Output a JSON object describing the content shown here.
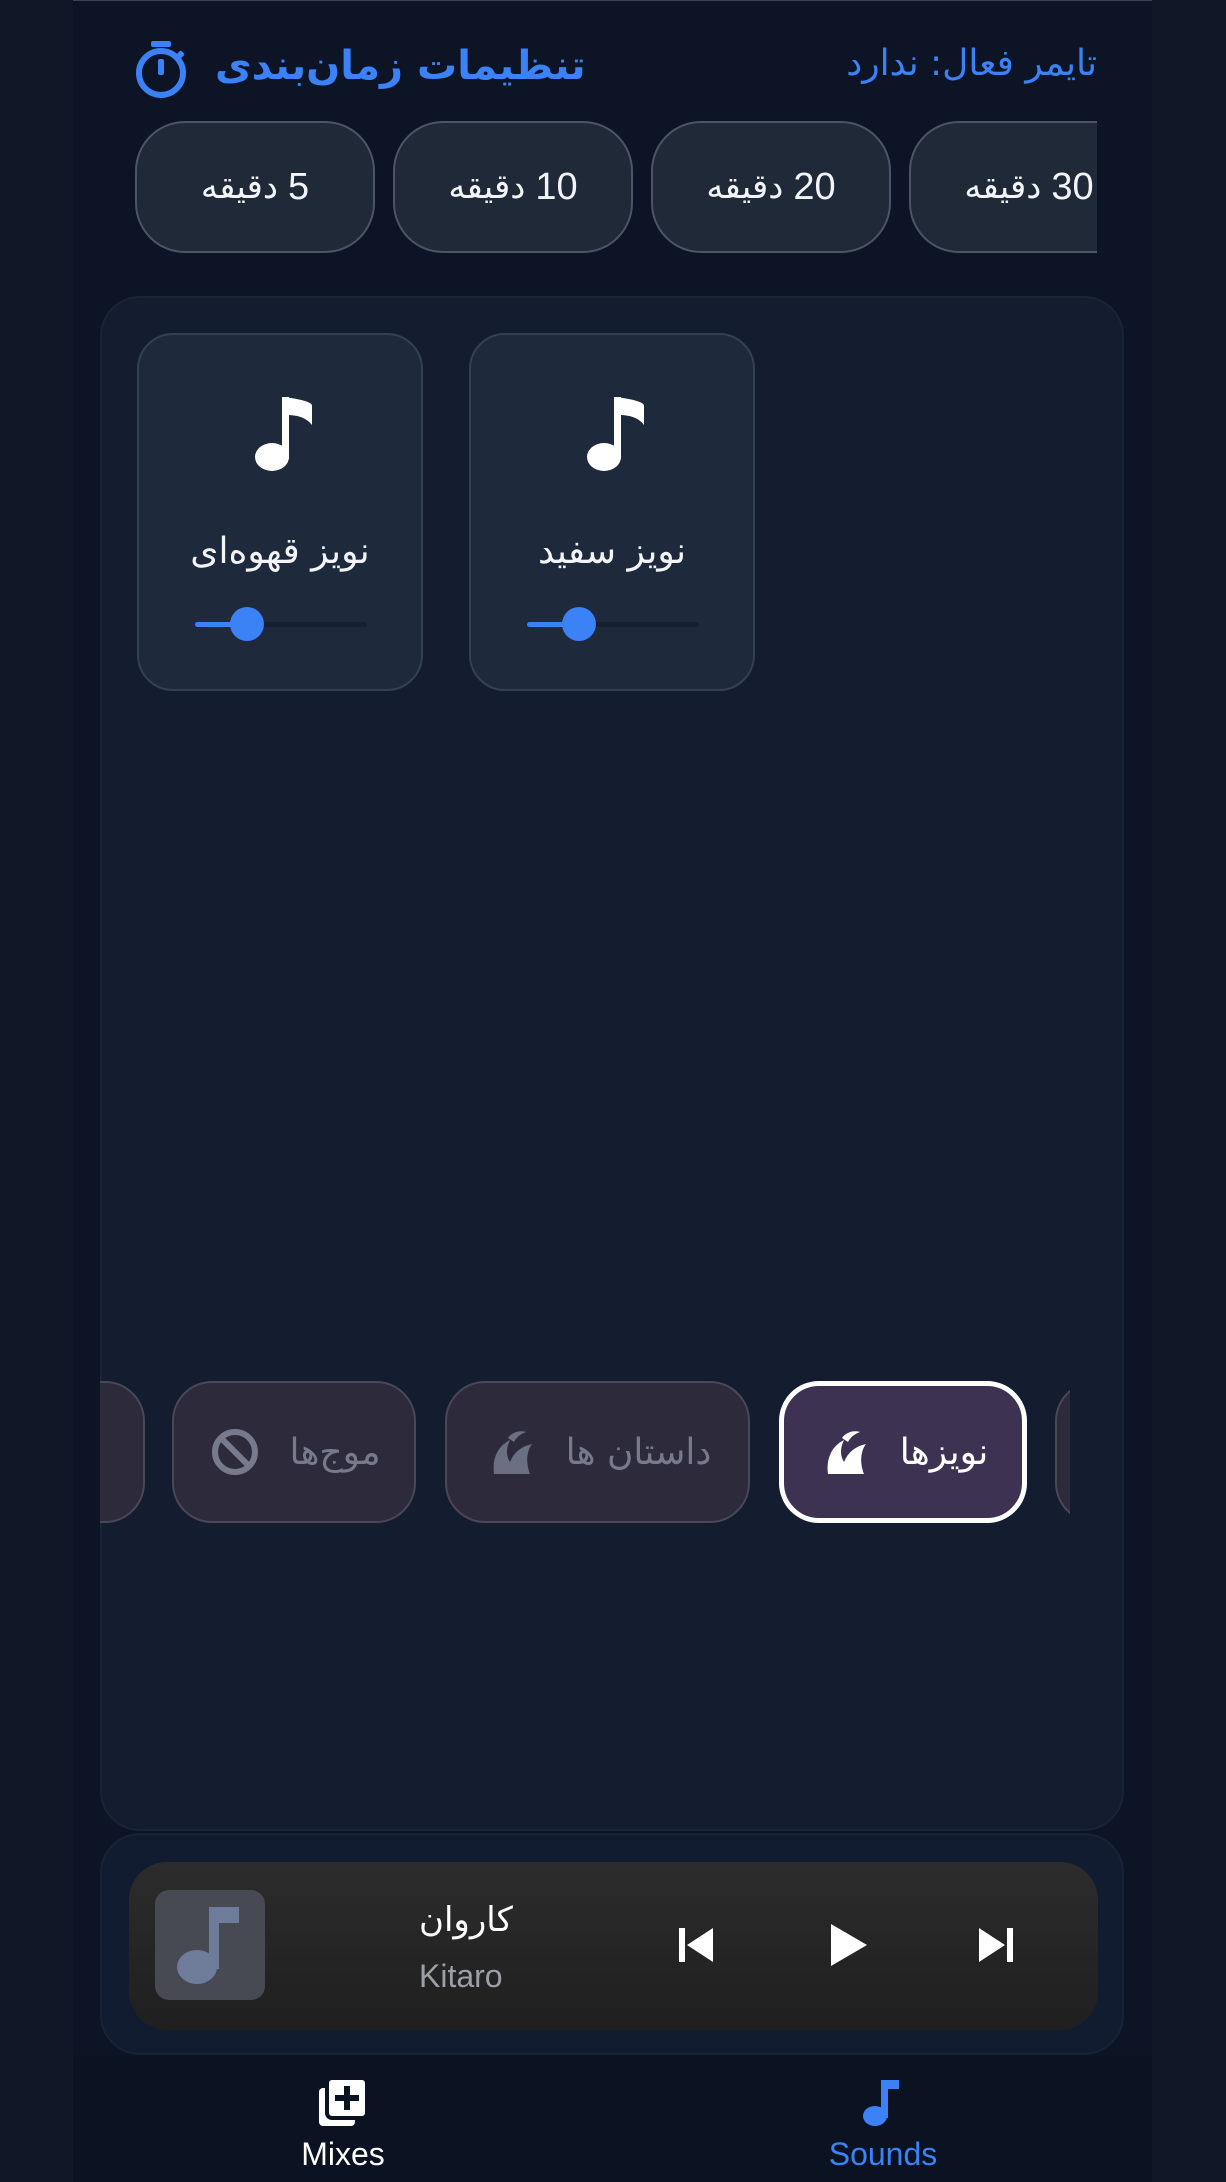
{
  "timer": {
    "title": "تنظیمات زمان‌بندی",
    "status": "تایمر فعال: ندارد",
    "options": [
      {
        "num": "5",
        "unit": "دقیقه"
      },
      {
        "num": "10",
        "unit": "دقیقه"
      },
      {
        "num": "20",
        "unit": "دقیقه"
      },
      {
        "num": "30",
        "unit": "دقیقه"
      }
    ]
  },
  "sounds": [
    {
      "label": "نویز قهوه‌ای",
      "volume": 0.3
    },
    {
      "label": "نویز سفید",
      "volume": 0.3
    }
  ],
  "categories": [
    {
      "label": "موج‌ها",
      "icon": "block-icon",
      "active": false
    },
    {
      "label": "داستان ها",
      "icon": "leaf-icon",
      "active": false
    },
    {
      "label": "نویزها",
      "icon": "leaf-icon",
      "active": true
    }
  ],
  "player": {
    "title": "کاروان",
    "artist": "Kitaro",
    "icons": [
      "music-note-icon",
      "skip-previous-icon",
      "play-icon",
      "skip-next-icon"
    ]
  },
  "nav": {
    "mixes": "Mixes",
    "sounds": "Sounds"
  },
  "colors": {
    "accent": "#3b82f6",
    "background": "#0c1426",
    "panel": "#141d2f",
    "card": "#1e293b",
    "active_category": "#3d3252"
  }
}
